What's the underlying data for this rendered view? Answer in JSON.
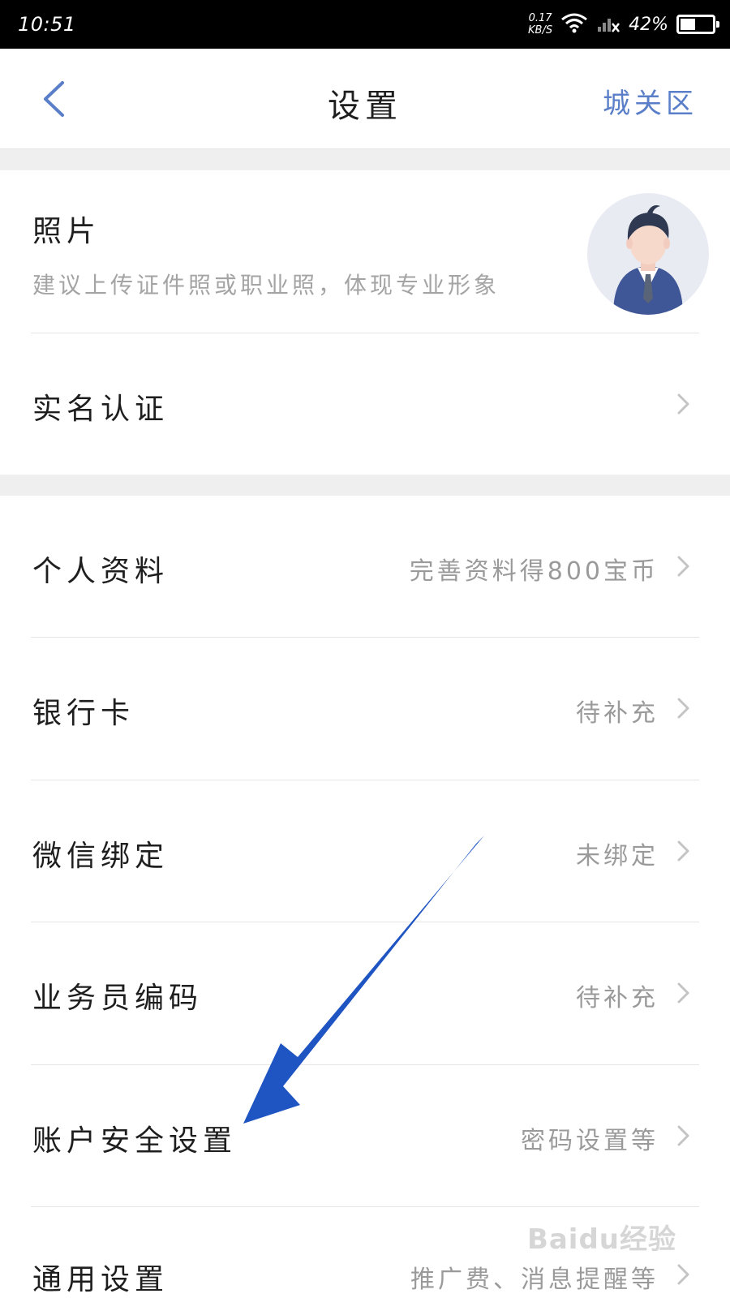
{
  "status_bar": {
    "time": "10:51",
    "net_speed_value": "0.17",
    "net_speed_unit": "KB/S",
    "battery_text": "42%",
    "battery_level": 0.42
  },
  "nav": {
    "title": "设置",
    "region": "城关区"
  },
  "photo": {
    "label": "照片",
    "hint": "建议上传证件照或职业照，体现专业形象"
  },
  "realname": {
    "label": "实名认证"
  },
  "items": [
    {
      "label": "个人资料",
      "value": "完善资料得800宝币"
    },
    {
      "label": "银行卡",
      "value": "待补充"
    },
    {
      "label": "微信绑定",
      "value": "未绑定"
    },
    {
      "label": "业务员编码",
      "value": "待补充"
    },
    {
      "label": "账户安全设置",
      "value": "密码设置等"
    },
    {
      "label": "通用设置",
      "value": "推广费、消息提醒等"
    }
  ],
  "watermark": "Baidu经验",
  "colors": {
    "accent": "#5a7fc8",
    "annotation_arrow": "#1f55c2",
    "section_gap": "#efefef"
  }
}
